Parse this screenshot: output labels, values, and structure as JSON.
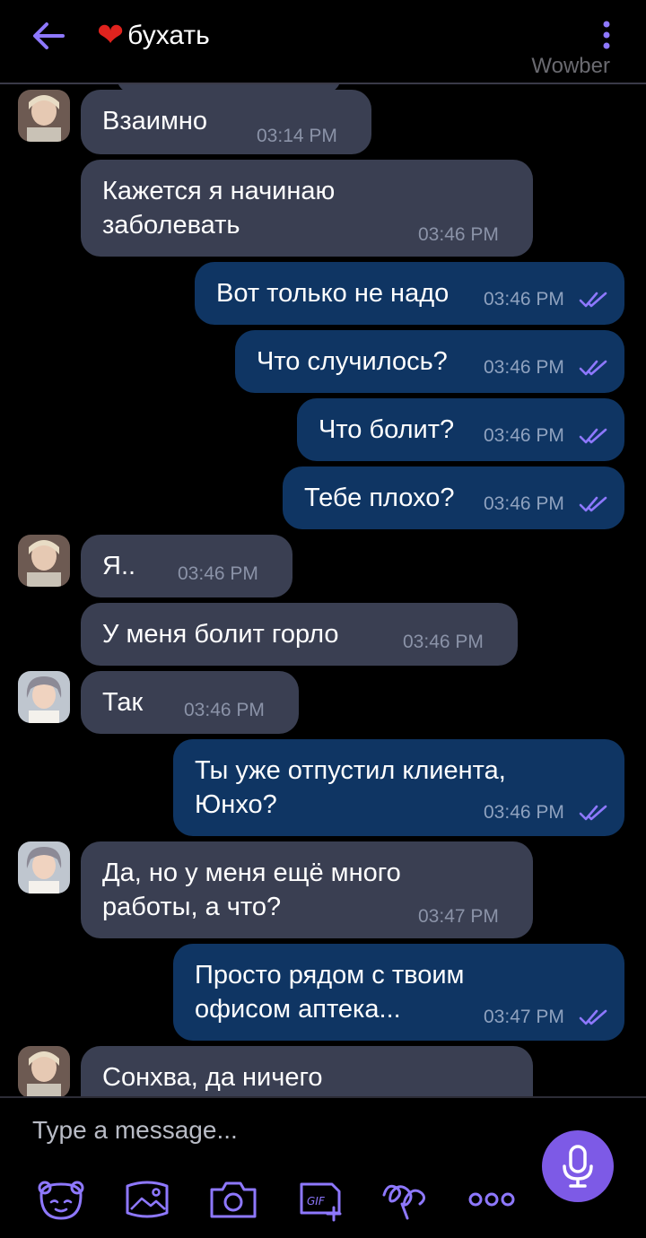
{
  "header": {
    "back_icon": "arrow-left-icon",
    "heart": "❤",
    "title": "бухать",
    "watermark": "Wowber",
    "more_icon": "more-vertical-icon"
  },
  "colors": {
    "accent": "#7d5ae6",
    "incoming": "#3a3f52",
    "outgoing": "#0f3563",
    "heart": "#e0231e"
  },
  "messages": [
    {
      "dir": "in",
      "avatar": "avatar-a",
      "text": "Взаимно",
      "time": "03:14 PM"
    },
    {
      "dir": "in",
      "text": "Кажется я начинаю\nзаболевать",
      "time": "03:46 PM"
    },
    {
      "dir": "out",
      "text": "Вот только не надо",
      "time": "03:46 PM",
      "read": true
    },
    {
      "dir": "out",
      "text": "Что случилось?",
      "time": "03:46 PM",
      "read": true
    },
    {
      "dir": "out",
      "text": "Что болит?",
      "time": "03:46 PM",
      "read": true
    },
    {
      "dir": "out",
      "text": "Тебе плохо?",
      "time": "03:46 PM",
      "read": true
    },
    {
      "dir": "in",
      "avatar": "avatar-a",
      "text": "Я..",
      "time": "03:46 PM"
    },
    {
      "dir": "in",
      "text": "У меня болит горло",
      "time": "03:46 PM"
    },
    {
      "dir": "in",
      "avatar": "avatar-b",
      "text": "Так",
      "time": "03:46 PM"
    },
    {
      "dir": "out",
      "text": "Ты уже отпустил клиента,\nЮнхо?",
      "time": "03:46 PM",
      "read": true
    },
    {
      "dir": "in",
      "avatar": "avatar-b",
      "text": "Да, но у меня ещё много\nработы, а что?",
      "time": "03:47 PM"
    },
    {
      "dir": "out",
      "text": "Просто рядом с твоим\nофисом аптека...",
      "time": "03:47 PM",
      "read": true
    },
    {
      "dir": "in",
      "avatar": "avatar-a",
      "text": "Сонхва, да ничего",
      "time": ""
    }
  ],
  "composer": {
    "placeholder": "Type a message...",
    "mic_icon": "microphone-icon",
    "tools": [
      "bear-sticker-icon",
      "image-icon",
      "camera-icon",
      "gif-icon",
      "doodle-icon",
      "more-horizontal-icon"
    ]
  }
}
